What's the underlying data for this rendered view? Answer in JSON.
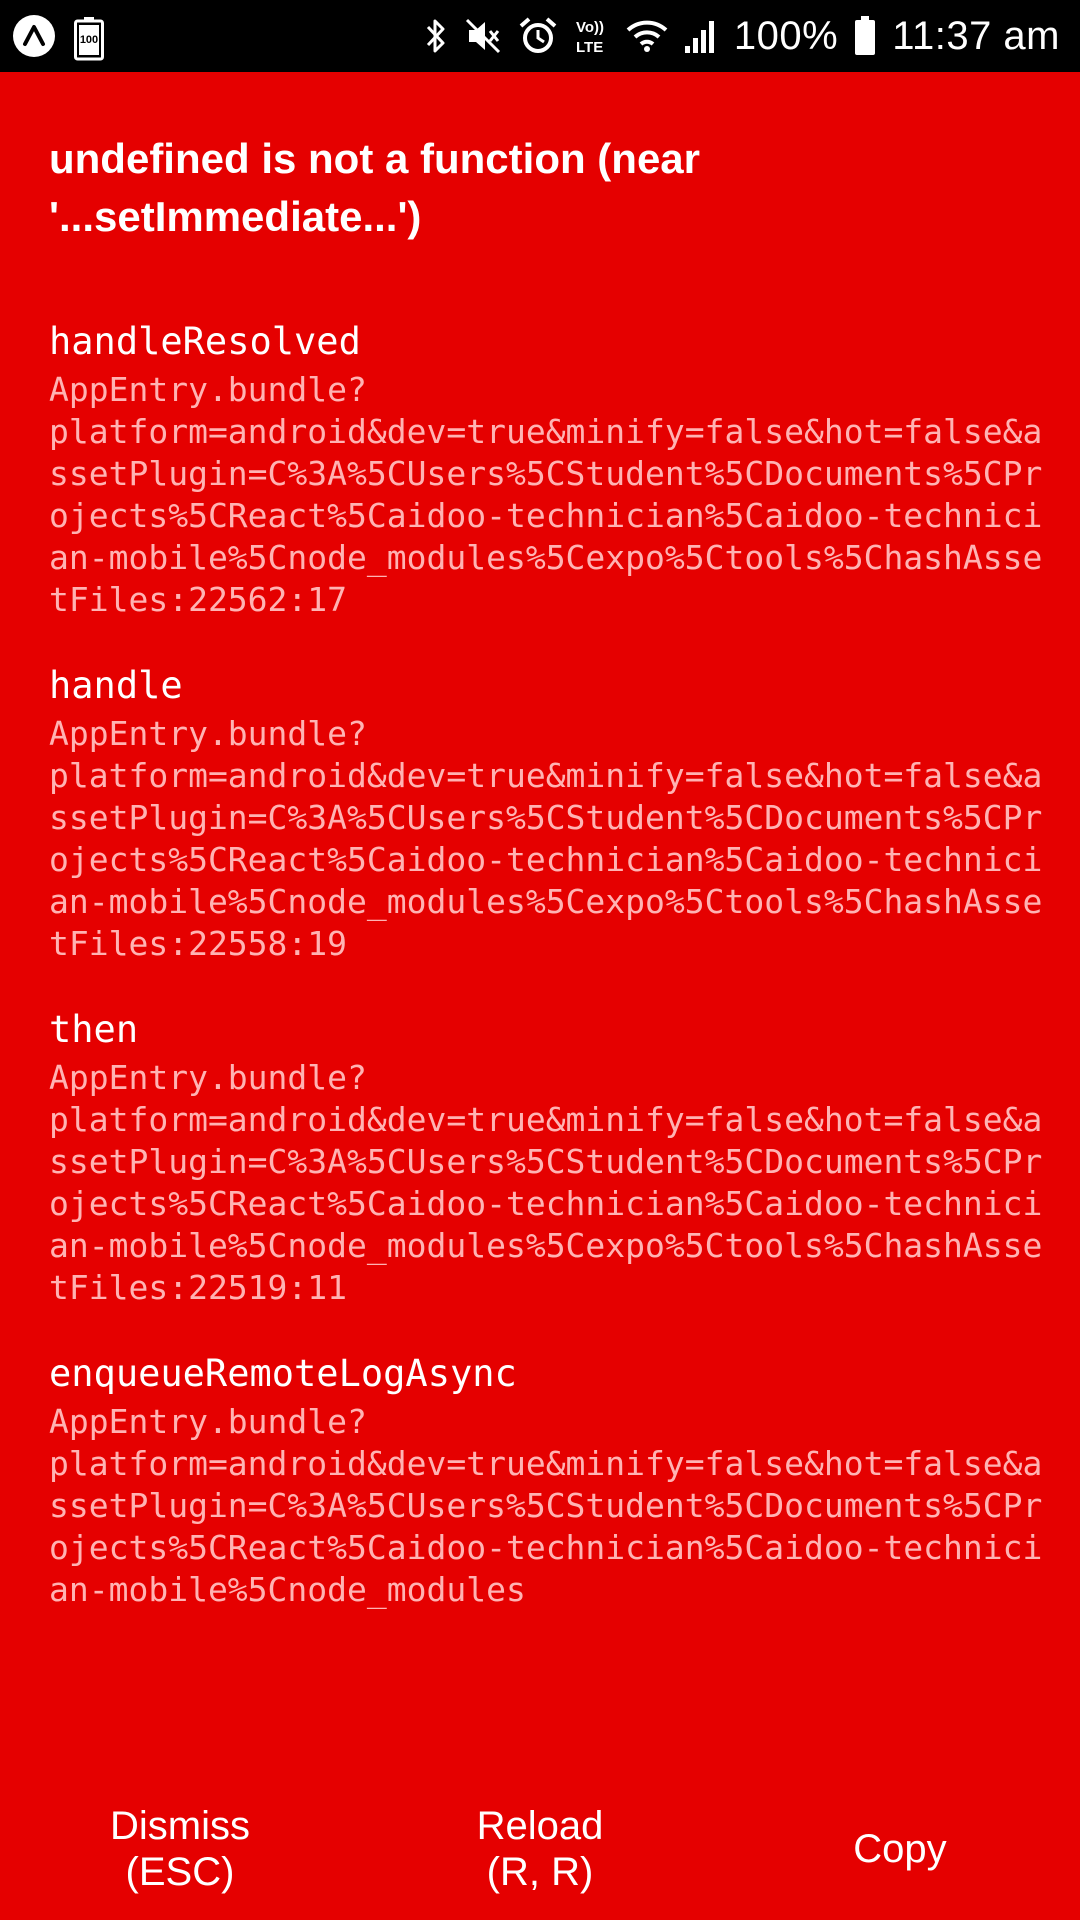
{
  "status_bar": {
    "battery_indicator_label": "100",
    "battery_percent": "100%",
    "time": "11:37 am",
    "icons": [
      "app-logo-icon",
      "battery-saver-icon",
      "bluetooth-icon",
      "mute-icon",
      "alarm-icon",
      "volte-icon",
      "wifi-icon",
      "signal-icon",
      "battery-icon"
    ]
  },
  "error": {
    "title": "undefined is not a function (near '...setImmediate...')",
    "stack": [
      {
        "method": "handleResolved",
        "location": "AppEntry.bundle?\nplatform=android&dev=true&minify=false&hot=false&assetPlugin=C%3A%5CUsers%5CStudent%5CDocuments%5CProjects%5CReact%5Caidoo-technician%5Caidoo-technician-mobile%5Cnode_modules%5Cexpo%5Ctools%5ChashAssetFiles:22562:17"
      },
      {
        "method": "handle",
        "location": "AppEntry.bundle?\nplatform=android&dev=true&minify=false&hot=false&assetPlugin=C%3A%5CUsers%5CStudent%5CDocuments%5CProjects%5CReact%5Caidoo-technician%5Caidoo-technician-mobile%5Cnode_modules%5Cexpo%5Ctools%5ChashAssetFiles:22558:19"
      },
      {
        "method": "then",
        "location": "AppEntry.bundle?\nplatform=android&dev=true&minify=false&hot=false&assetPlugin=C%3A%5CUsers%5CStudent%5CDocuments%5CProjects%5CReact%5Caidoo-technician%5Caidoo-technician-mobile%5Cnode_modules%5Cexpo%5Ctools%5ChashAssetFiles:22519:11"
      },
      {
        "method": "enqueueRemoteLogAsync",
        "location": "AppEntry.bundle?\nplatform=android&dev=true&minify=false&hot=false&assetPlugin=C%3A%5CUsers%5CStudent%5CDocuments%5CProjects%5CReact%5Caidoo-technician%5Caidoo-technician-mobile%5Cnode_modules"
      }
    ]
  },
  "buttons": {
    "dismiss": "Dismiss\n(ESC)",
    "reload": "Reload\n(R, R)",
    "copy": "Copy"
  },
  "colors": {
    "background": "#e50000",
    "status_bar": "#000000",
    "primary_text": "#ffffff",
    "secondary_text": "#ffb3b3"
  }
}
